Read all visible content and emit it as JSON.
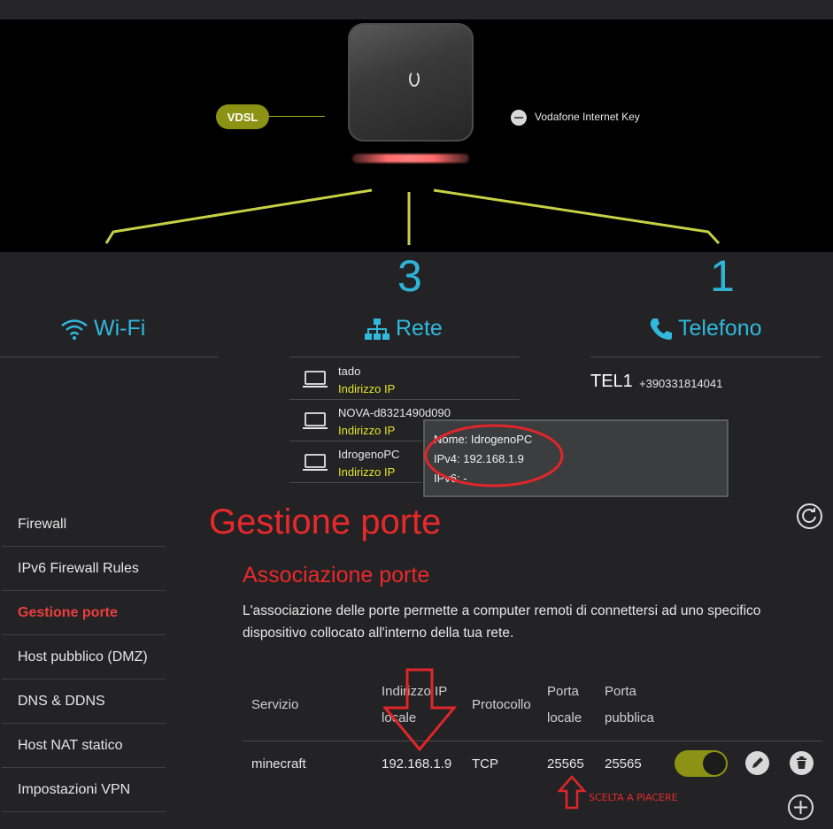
{
  "hero": {
    "vdsl_label": "VDSL",
    "internet_key_label": "Vodafone Internet Key"
  },
  "categories": {
    "wifi": {
      "count": "",
      "label": "Wi-Fi"
    },
    "rete": {
      "count": "3",
      "label": "Rete"
    },
    "telefono": {
      "count": "1",
      "label": "Telefono"
    }
  },
  "devices": [
    {
      "name": "tado",
      "ip_label": "Indirizzo IP"
    },
    {
      "name": "NOVA-d8321490d090",
      "ip_label": "Indirizzo IP"
    },
    {
      "name": "IdrogenoPC",
      "ip_label": "Indirizzo IP"
    }
  ],
  "tooltip": {
    "name_line": "Nome: IdrogenoPC",
    "ipv4_line": "IPv4: 192.168.1.9",
    "ipv6_line": "IPv6: -"
  },
  "telefono": {
    "line": "TEL1",
    "number": "+390331814041"
  },
  "sidebar": {
    "items": [
      {
        "label": "Firewall",
        "active": false
      },
      {
        "label": "IPv6 Firewall Rules",
        "active": false
      },
      {
        "label": "Gestione porte",
        "active": true
      },
      {
        "label": "Host pubblico (DMZ)",
        "active": false
      },
      {
        "label": "DNS & DDNS",
        "active": false
      },
      {
        "label": "Host NAT statico",
        "active": false
      },
      {
        "label": "Impostazioni VPN",
        "active": false
      }
    ]
  },
  "main": {
    "title": "Gestione porte",
    "subtitle": "Associazione porte",
    "description_line1": "L'associazione delle porte permette a computer remoti di connettersi ad uno specifico",
    "description_line2": "dispositivo collocato all'interno della tua rete.",
    "table": {
      "headers": {
        "servizio": "Servizio",
        "ip_1": "Indirizzo IP",
        "ip_2": "locale",
        "protocollo": "Protocollo",
        "porta_locale_1": "Porta",
        "porta_locale_2": "locale",
        "porta_pubblica_1": "Porta",
        "porta_pubblica_2": "pubblica"
      },
      "rows": [
        {
          "servizio": "minecraft",
          "ip": "192.168.1.9",
          "protocollo": "TCP",
          "porta_locale": "25565",
          "porta_pubblica": "25565",
          "enabled": true
        }
      ]
    }
  },
  "annotation": {
    "note": "SCELTA A PIACERE"
  },
  "colors": {
    "accent_cyan": "#31b8dd",
    "brand_red": "#e8292b",
    "ip_yellow": "#e3e32a",
    "toggle_green": "#8c9314"
  },
  "icons": [
    "wifi-icon",
    "network-icon",
    "phone-icon",
    "laptop-icon",
    "refresh-icon",
    "edit-icon",
    "trash-icon",
    "plus-icon",
    "minus-icon"
  ]
}
